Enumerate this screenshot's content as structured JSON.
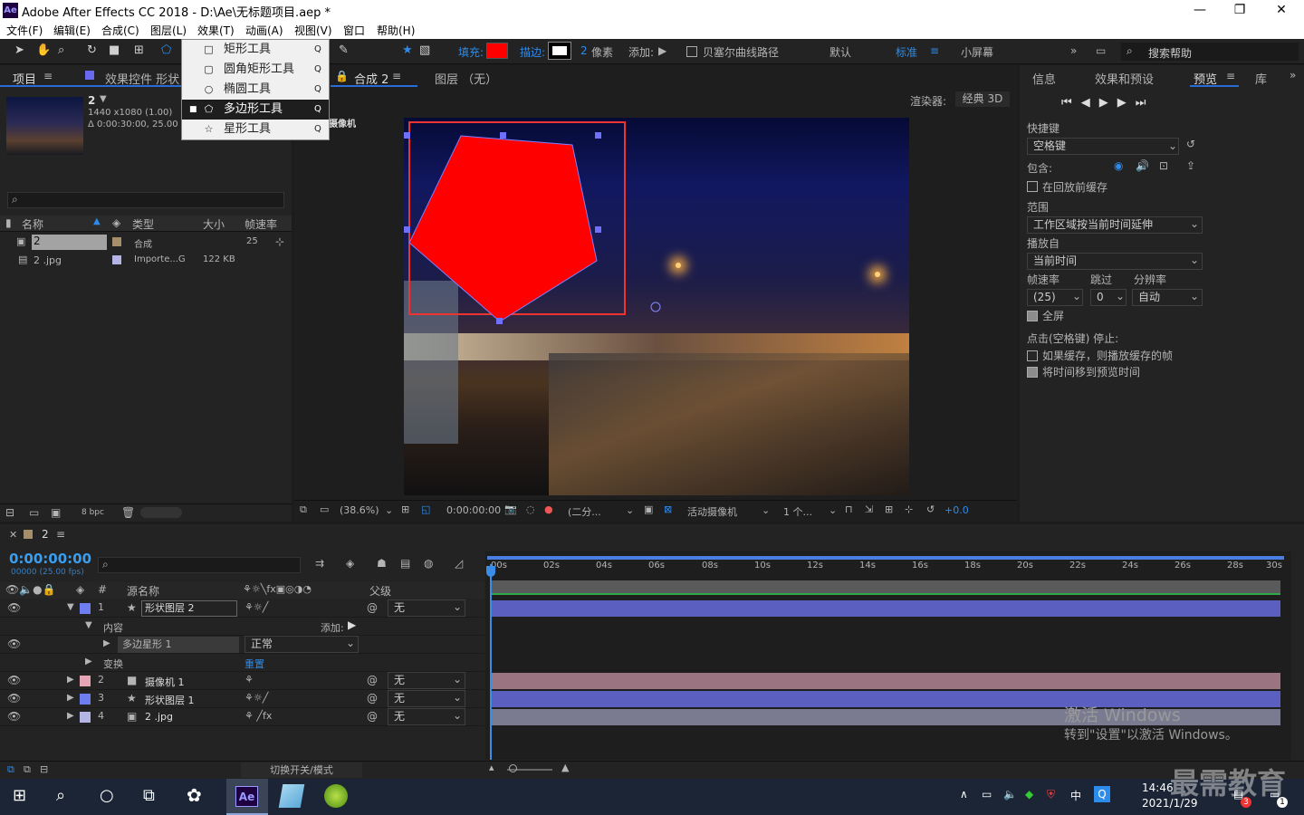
{
  "window": {
    "title": "Adobe After Effects CC 2018 - D:\\Ae\\无标题项目.aep *",
    "logo": "Ae",
    "min_icon": "—",
    "max_icon": "❐",
    "close_icon": "✕"
  },
  "menu": [
    "文件(F)",
    "编辑(E)",
    "合成(C)",
    "图层(L)",
    "效果(T)",
    "动画(A)",
    "视图(V)",
    "窗口",
    "帮助(H)"
  ],
  "toolbar": {
    "fill_label": "填充:",
    "stroke_label": "描边:",
    "stroke_width": "2",
    "stroke_unit": "像素",
    "add_label": "添加:",
    "bezier_label": "贝塞尔曲线路径",
    "workspaces": [
      "默认",
      "标准",
      "小屏幕"
    ],
    "search_placeholder": "搜索帮助",
    "fill_color": "#ff0000"
  },
  "shape_menu": {
    "items": [
      {
        "label": "矩形工具",
        "key": "Q",
        "icon": "□"
      },
      {
        "label": "圆角矩形工具",
        "key": "Q",
        "icon": "▢"
      },
      {
        "label": "椭圆工具",
        "key": "Q",
        "icon": "○"
      },
      {
        "label": "多边形工具",
        "key": "Q",
        "icon": "⬠",
        "selected": true
      },
      {
        "label": "星形工具",
        "key": "Q",
        "icon": "☆"
      }
    ]
  },
  "project_panel": {
    "tabs": [
      "项目",
      "效果控件 形状"
    ],
    "comp_name": "2",
    "comp_info1": "1440 x1080 (1.00)",
    "comp_info2": "Δ 0:00:30:00, 25.00 fps",
    "columns": [
      "名称",
      "类型",
      "大小",
      "帧速率"
    ],
    "items": [
      {
        "name": "2",
        "type": "合成",
        "size": "",
        "fps": "25",
        "color": "#a58f6a"
      },
      {
        "name": "2 .jpg",
        "type": "Importe...G",
        "size": "122 KB",
        "fps": "",
        "color": "#b4b4e6"
      }
    ],
    "bpc": "8 bpc"
  },
  "comp_panel": {
    "tab": "合成 2",
    "layer_tab": "图层 （无）",
    "renderer_label": "渲染器:",
    "renderer": "经典 3D",
    "camera_label": "摄像机",
    "zoom": "(38.6%)",
    "timecode": "0:00:00:00",
    "resolution": "(二分...",
    "view": "活动摄像机",
    "views": "1 个...",
    "exposure": "+0.0"
  },
  "right_panel": {
    "tabs": [
      "信息",
      "效果和预设",
      "预览",
      "库"
    ],
    "shortcut_label": "快捷键",
    "shortcut": "空格键",
    "include_label": "包含:",
    "cache_label": "在回放前缓存",
    "range_label": "范围",
    "range": "工作区域按当前时间延伸",
    "play_from_label": "播放自",
    "play_from": "当前时间",
    "fps_label": "帧速率",
    "skip_label": "跳过",
    "res_label": "分辨率",
    "fps": "(25)",
    "skip": "0",
    "res": "自动",
    "fullscreen_label": "全屏",
    "stop_label": "点击(空格键) 停止:",
    "if_cached_label": "如果缓存，则播放缓存的帧",
    "move_time_label": "将时间移到预览时间"
  },
  "timeline": {
    "tab": "2",
    "timecode": "0:00:00:00",
    "frame_info": "00000 (25.00 fps)",
    "col_source": "源名称",
    "col_parent": "父级",
    "ruler": [
      "00s",
      "02s",
      "04s",
      "06s",
      "08s",
      "10s",
      "12s",
      "14s",
      "16s",
      "18s",
      "20s",
      "22s",
      "24s",
      "26s",
      "28s",
      "30s"
    ],
    "layers": [
      {
        "num": "1",
        "name": "形状图层 2",
        "parent": "无",
        "color": "#6e7ef0",
        "bar": "#5b5fbf",
        "icon": "★"
      },
      {
        "num": "2",
        "name": "摄像机 1",
        "parent": "无",
        "color": "#e6a5b4",
        "bar": "#9a7480",
        "icon": "■"
      },
      {
        "num": "3",
        "name": "形状图层 1",
        "parent": "无",
        "color": "#6e7ef0",
        "bar": "#5b5fbf",
        "icon": "★"
      },
      {
        "num": "4",
        "name": "2 .jpg",
        "parent": "无",
        "color": "#b4b4e6",
        "bar": "#7a7a90",
        "icon": "▣"
      }
    ],
    "contents_label": "内容",
    "add_label": "添加:",
    "polystar": "多边星形 1",
    "blend": "正常",
    "transform_label": "变换",
    "reset_label": "重置",
    "toggle_label": "切换开关/模式"
  },
  "watermark": {
    "line1": "激活 Windows",
    "line2": "转到\"设置\"以激活 Windows。",
    "brand": "最需教育"
  },
  "taskbar": {
    "time": "14:46",
    "date": "2021/1/29",
    "ime": "中",
    "badge": "3",
    "notif": "1"
  }
}
